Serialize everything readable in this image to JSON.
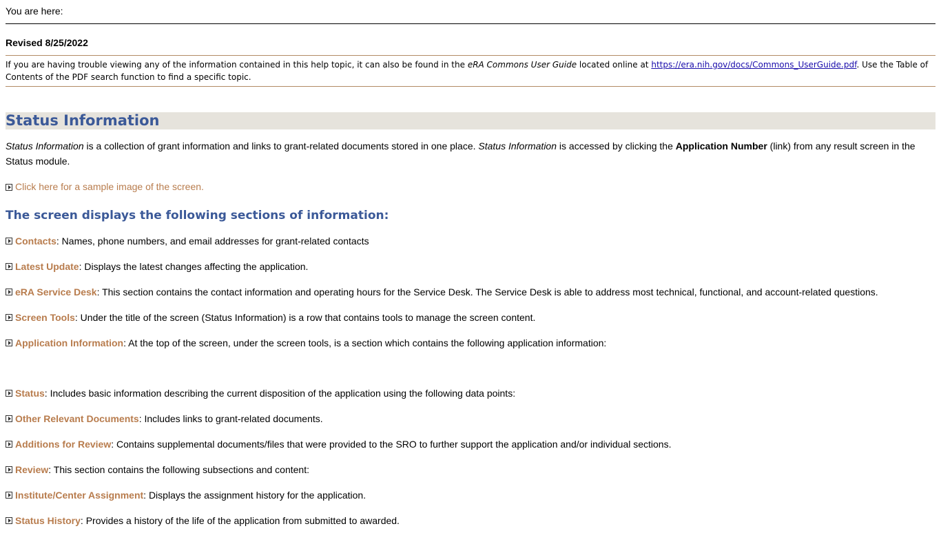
{
  "breadcrumb": {
    "label": "You are here:"
  },
  "revised": "Revised 8/25/2022",
  "notice": {
    "prefix": "If you are having trouble viewing any of the information contained in this help topic, it can also be found in the ",
    "guide": "eRA Commons User Guide",
    "middle": " located online at ",
    "url": "https://era.nih.gov/docs/Commons_UserGuide.pdf",
    "suffix": ". Use the Table of Contents of the PDF search function to find a specific topic."
  },
  "status": {
    "title": "Status Information",
    "intro_em1": "Status Information",
    "intro_t1": " is a collection of grant information and links to grant-related documents stored in one place. ",
    "intro_em2": "Status Information",
    "intro_t2": " is accessed by clicking the ",
    "intro_strong": "Application Number",
    "intro_t3": " (link) from any result screen in the Status module.",
    "sample_link": "Click here for a sample image of the screen."
  },
  "sections_heading": "The screen displays the following sections of information:",
  "sections": [
    {
      "term": "Contacts",
      "text": ": Names, phone numbers, and email addresses for grant-related contacts"
    },
    {
      "term": "Latest Update",
      "text": ": Displays the latest changes affecting the application."
    },
    {
      "term": "eRA Service Desk",
      "text": ": This section contains the contact information and operating hours for the Service Desk. The Service Desk is able to address most technical, functional, and account-related questions."
    },
    {
      "term": "Screen Tools",
      "text": ": Under the title of the screen (Status Information) is a row that contains tools to manage the screen content."
    },
    {
      "term": "Application Information",
      "text": ": At the top of the screen, under the screen tools, is a section which contains the following application information:"
    }
  ],
  "sections2": [
    {
      "term": "Status",
      "text": ": Includes basic information describing the current disposition of the application using the following data points:"
    },
    {
      "term": "Other Relevant Documents",
      "text": ": Includes links to grant-related documents."
    },
    {
      "term": "Additions for Review",
      "text": ": Contains supplemental documents/files that were provided to the SRO to further support the application and/or individual sections."
    },
    {
      "term": "Review",
      "text": ": This section contains the following subsections and content:"
    },
    {
      "term": "Institute/Center Assignment",
      "text": ": Displays the assignment history for the application."
    },
    {
      "term": "Status History",
      "text": ": Provides a history of the life of the application from submitted to awarded."
    }
  ]
}
